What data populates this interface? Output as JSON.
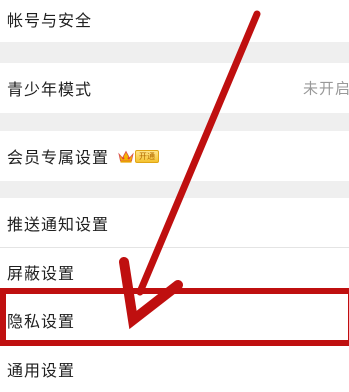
{
  "settings": {
    "items": [
      {
        "label": "帐号与安全"
      },
      {
        "label": "青少年模式",
        "value": "未开启"
      },
      {
        "label": "会员专属设置",
        "badge": "开通"
      },
      {
        "label": "推送通知设置"
      },
      {
        "label": "屏蔽设置"
      },
      {
        "label": "隐私设置"
      },
      {
        "label": "通用设置"
      }
    ]
  },
  "annotation": {
    "color": "#bf0f0f",
    "highlighted_item": "隐私设置"
  }
}
